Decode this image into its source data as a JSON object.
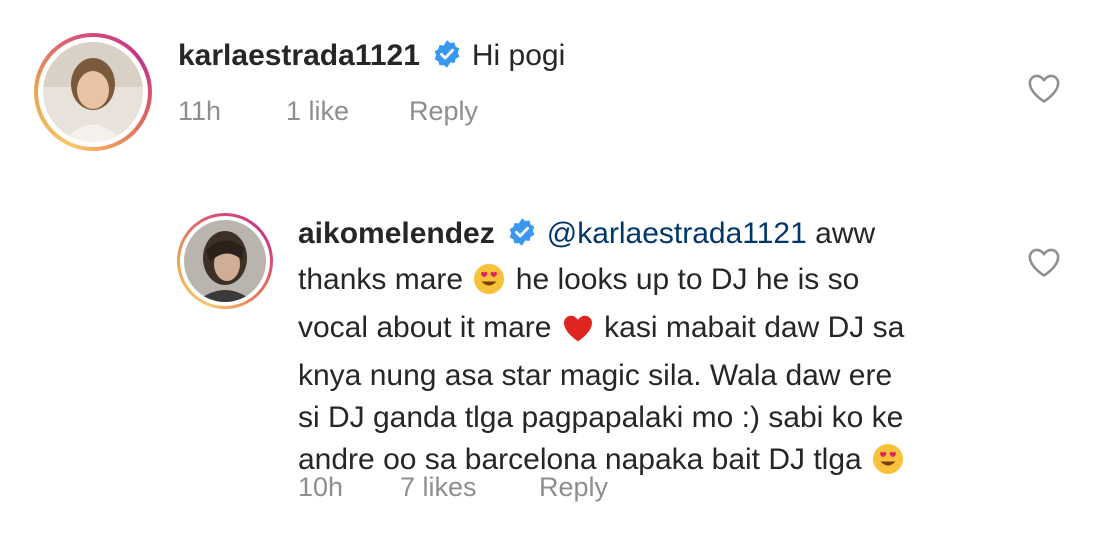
{
  "comments": [
    {
      "username": "karlaestrada1121",
      "text": "Hi pogi",
      "time": "11h",
      "likes": "1 like",
      "reply_label": "Reply"
    },
    {
      "username": "aikomelendez",
      "mention": "@karlaestrada1121",
      "lines": [
        " aww",
        "thanks mare",
        " he looks up to DJ he is so",
        "vocal about it mare",
        " kasi mabait daw DJ sa",
        "knya nung asa star magic sila. Wala daw ere",
        "si DJ ganda tlga pagpapalaki mo :) sabi ko ke",
        "andre oo sa barcelona napaka bait DJ tlga"
      ],
      "time": "10h",
      "likes": "7 likes",
      "reply_label": "Reply"
    }
  ],
  "icons": {
    "verified": "verified-badge-icon",
    "like": "heart-outline-icon",
    "emoji_1": "heart-eyes-emoji",
    "emoji_2": "red-heart-emoji"
  },
  "colors": {
    "verified_blue": "#3897f0",
    "mention": "#00376b",
    "meta_gray": "#8e8e8e"
  }
}
